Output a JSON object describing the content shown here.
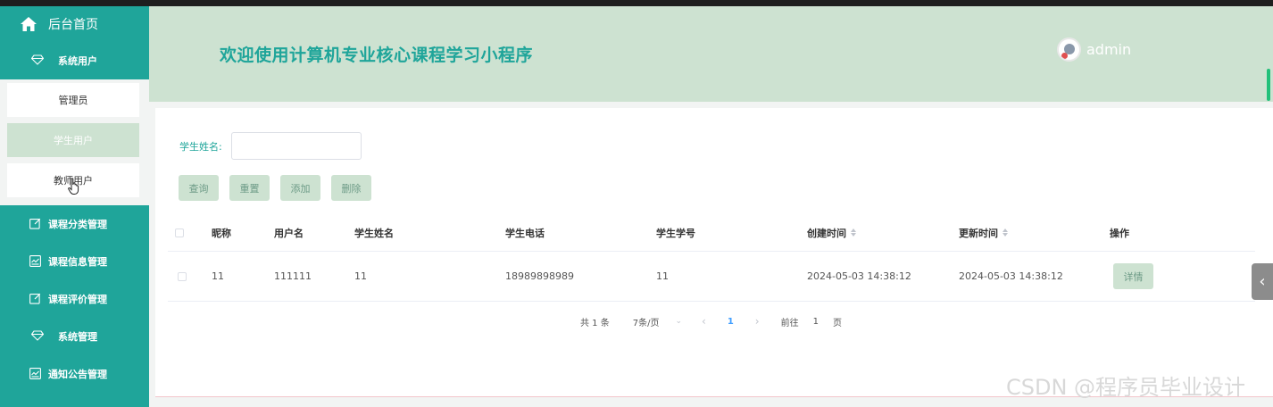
{
  "sidebar": {
    "home_label": "后台首页",
    "groups": [
      {
        "label": "系统用户",
        "icon": "diamond-icon"
      },
      {
        "label": "课程分类管理",
        "icon": "edit-icon"
      },
      {
        "label": "课程信息管理",
        "icon": "chart-icon"
      },
      {
        "label": "课程评价管理",
        "icon": "edit-icon"
      },
      {
        "label": "系统管理",
        "icon": "diamond-icon"
      },
      {
        "label": "通知公告管理",
        "icon": "chart-icon"
      }
    ],
    "sub_items": [
      {
        "label": "管理员"
      },
      {
        "label": "学生用户",
        "active": true
      },
      {
        "label": "教师用户"
      }
    ]
  },
  "header": {
    "title": "欢迎使用计算机专业核心课程学习小程序",
    "username": "admin"
  },
  "search": {
    "label": "学生姓名:",
    "value": ""
  },
  "actions": {
    "query": "查询",
    "reset": "重置",
    "add": "添加",
    "delete": "删除"
  },
  "table": {
    "columns": [
      "昵称",
      "用户名",
      "学生姓名",
      "学生电话",
      "学生学号",
      "创建时间",
      "更新时间",
      "操作"
    ],
    "rows": [
      {
        "nickname": "11",
        "username": "111111",
        "student_name": "11",
        "phone": "18989898989",
        "student_no": "11",
        "created": "2024-05-03 14:38:12",
        "updated": "2024-05-03 14:38:12",
        "action": "详情"
      }
    ]
  },
  "pagination": {
    "total": "共 1 条",
    "page_size": "7条/页",
    "current_page": "1",
    "goto_prefix": "前往",
    "goto_value": "1",
    "goto_suffix": "页"
  },
  "watermark": "CSDN @程序员毕业设计",
  "colors": {
    "sidebar": "#1fa59a",
    "header": "#cde2d1",
    "button": "#cde2d1",
    "accent": "#409eff"
  }
}
